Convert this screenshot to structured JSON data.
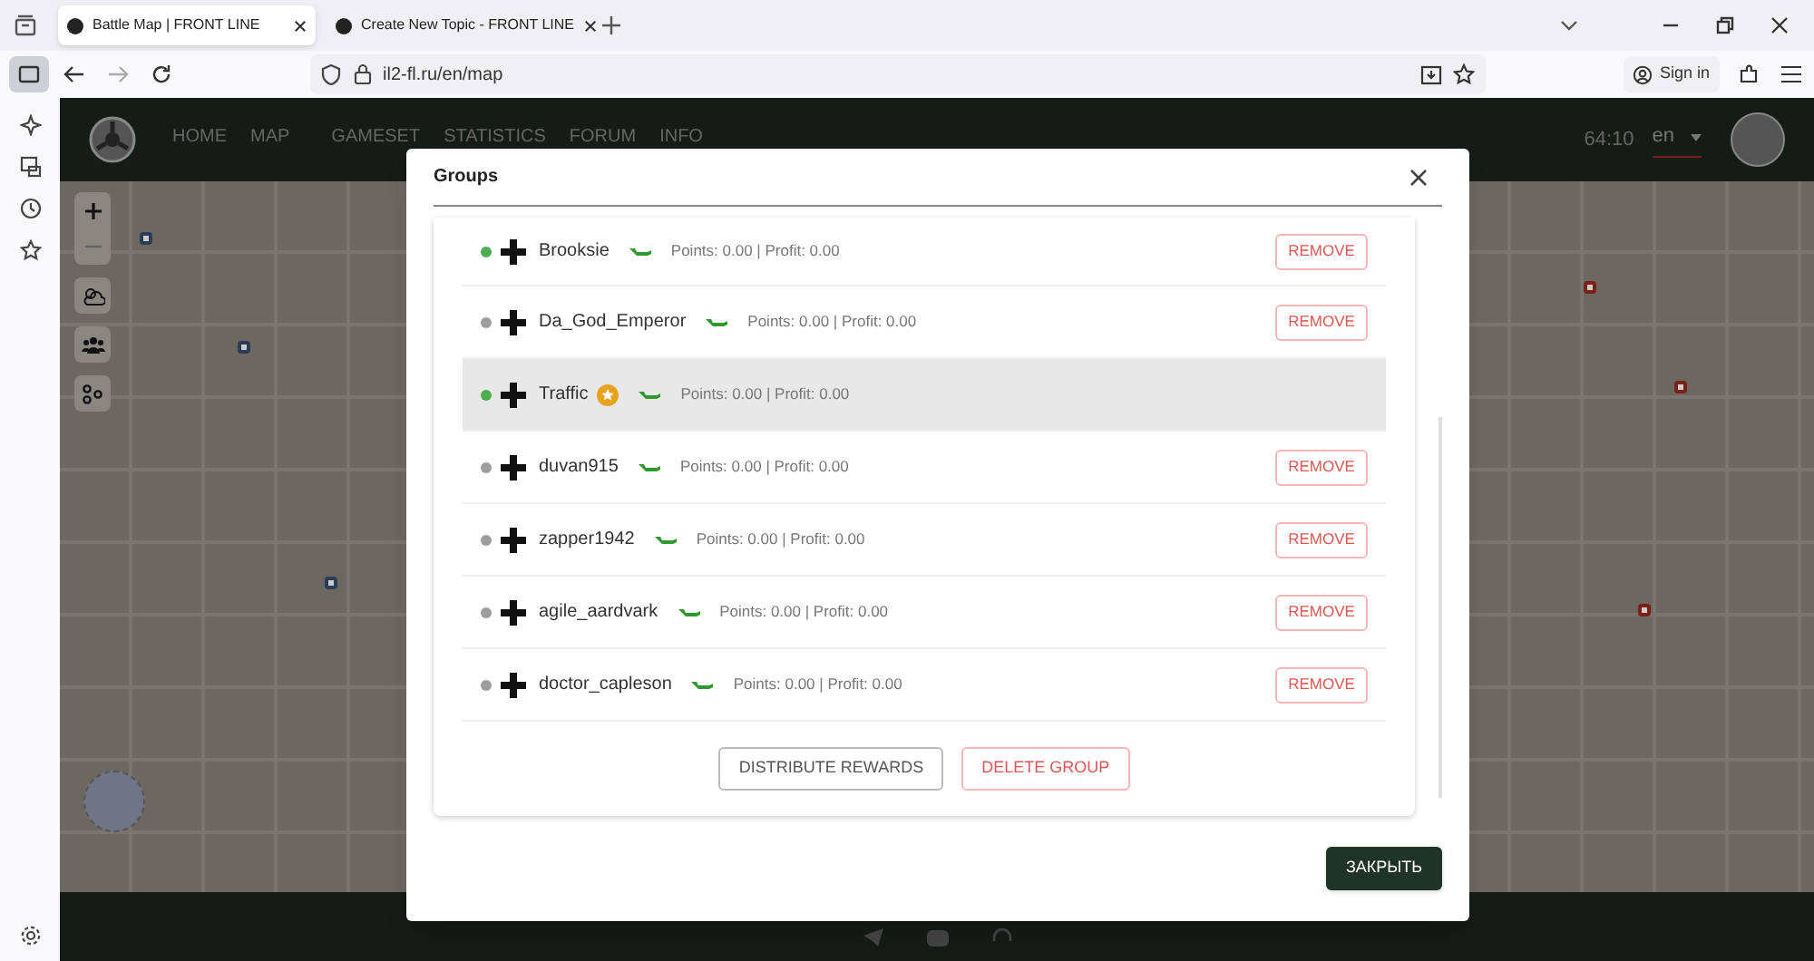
{
  "browser": {
    "tabs": [
      {
        "title": "Battle Map | FRONT LINE",
        "selected": true
      },
      {
        "title": "Create New Topic - FRONT LINE",
        "selected": false
      }
    ],
    "url": "il2-fl.ru/en/map",
    "sign_in": "Sign in"
  },
  "site": {
    "nav": [
      "HOME",
      "MAP",
      "GAMESET",
      "STATISTICS",
      "FORUM",
      "INFO"
    ],
    "time": "64:10",
    "language": "en"
  },
  "dialog": {
    "title": "Groups",
    "members": [
      {
        "name": "Brooksie",
        "online": true,
        "leader": false,
        "highlighted": false,
        "stats": "Points: 0.00 | Profit: 0.00",
        "remove": "REMOVE"
      },
      {
        "name": "Da_God_Emperor",
        "online": false,
        "leader": false,
        "highlighted": false,
        "stats": "Points: 0.00 | Profit: 0.00",
        "remove": "REMOVE"
      },
      {
        "name": "Traffic",
        "online": true,
        "leader": true,
        "highlighted": true,
        "stats": "Points: 0.00 | Profit: 0.00"
      },
      {
        "name": "duvan915",
        "online": false,
        "leader": false,
        "highlighted": false,
        "stats": "Points: 0.00 | Profit: 0.00",
        "remove": "REMOVE"
      },
      {
        "name": "zapper1942",
        "online": false,
        "leader": false,
        "highlighted": false,
        "stats": "Points: 0.00 | Profit: 0.00",
        "remove": "REMOVE"
      },
      {
        "name": "agile_aardvark",
        "online": false,
        "leader": false,
        "highlighted": false,
        "stats": "Points: 0.00 | Profit: 0.00",
        "remove": "REMOVE"
      },
      {
        "name": "doctor_capleson",
        "online": false,
        "leader": false,
        "highlighted": false,
        "stats": "Points: 0.00 | Profit: 0.00",
        "remove": "REMOVE"
      }
    ],
    "distribute": "DISTRIBUTE REWARDS",
    "delete": "DELETE GROUP",
    "close": "ЗАКРЫТЬ"
  }
}
